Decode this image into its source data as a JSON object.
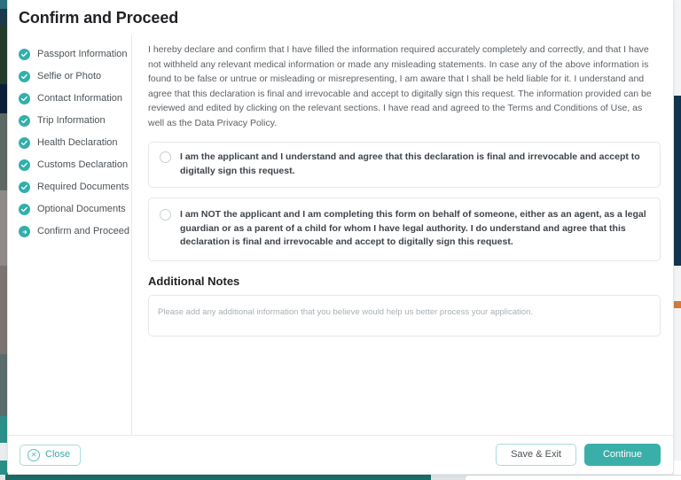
{
  "modal": {
    "title": "Confirm and Proceed"
  },
  "sidebar": {
    "items": [
      {
        "label": "Passport Information",
        "state": "complete",
        "icon": "check-circle-icon"
      },
      {
        "label": "Selfie or Photo",
        "state": "complete",
        "icon": "check-circle-icon"
      },
      {
        "label": "Contact Information",
        "state": "complete",
        "icon": "check-circle-icon"
      },
      {
        "label": "Trip Information",
        "state": "complete",
        "icon": "check-circle-icon"
      },
      {
        "label": "Health Declaration",
        "state": "complete",
        "icon": "check-circle-icon"
      },
      {
        "label": "Customs Declaration",
        "state": "complete",
        "icon": "check-circle-icon"
      },
      {
        "label": "Required Documents",
        "state": "complete",
        "icon": "check-circle-icon"
      },
      {
        "label": "Optional Documents",
        "state": "complete",
        "icon": "check-circle-icon"
      },
      {
        "label": "Confirm and Proceed",
        "state": "current",
        "icon": "arrow-right-circle-icon"
      }
    ]
  },
  "content": {
    "declaration": "I hereby declare and confirm that I have filled the information required accurately completely and correctly, and that I have not withheld any relevant medical information or made any misleading statements. In case any of the above information is found to be false or untrue or misleading or misrepresenting, I am aware that I shall be held liable for it. I understand and agree that this declaration is final and irrevocable and accept to digitally sign this request. The information provided can be reviewed and edited by clicking on the relevant sections. I have read and agreed to the Terms and Conditions of Use, as well as the Data Privacy Policy.",
    "options": [
      {
        "label": "I am the applicant and I understand and agree that this declaration is final and irrevocable and accept to digitally sign this request.",
        "selected": false
      },
      {
        "label": "I am NOT the applicant and I am completing this form on behalf of someone, either as an agent, as a legal guardian or as a parent of a child for whom I have legal authority. I do understand and agree that this declaration is final and irrevocable and accept to digitally sign this request.",
        "selected": false
      }
    ],
    "notes": {
      "title": "Additional Notes",
      "value": "",
      "placeholder": "Please add any additional information that you believe would help us better process your application."
    }
  },
  "footer": {
    "close_label": "Close",
    "save_label": "Save & Exit",
    "continue_label": "Continue"
  },
  "colors": {
    "accent_teal": "#3aafa9",
    "step_complete": "#33afaa",
    "border": "#e4e8ea",
    "text_primary": "#1f2124",
    "text_secondary": "#5c6166"
  }
}
